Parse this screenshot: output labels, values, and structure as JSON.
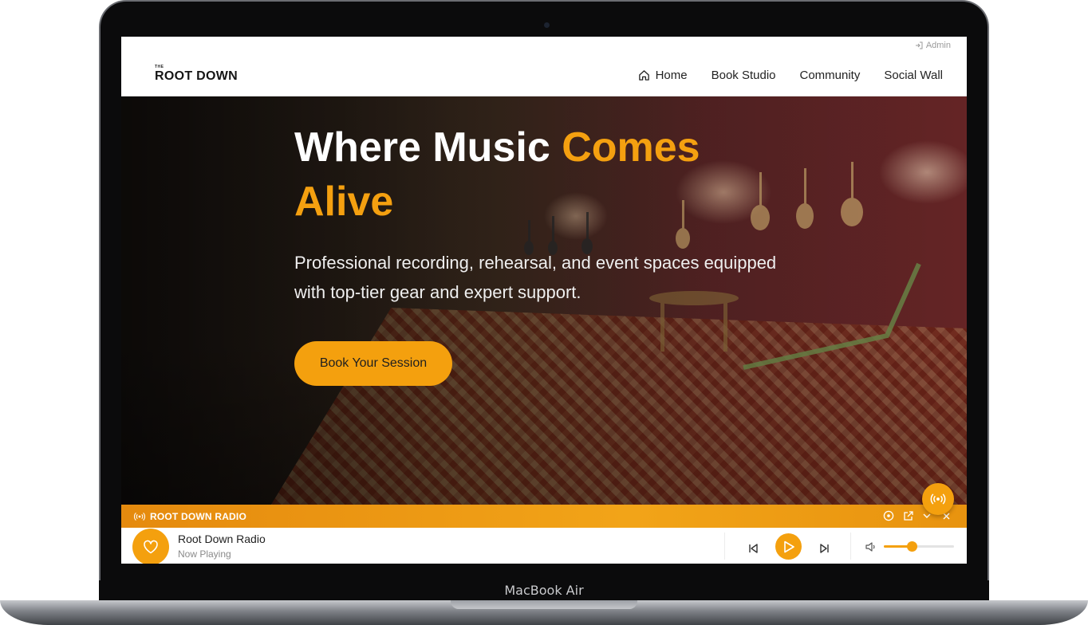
{
  "device": {
    "model_label": "MacBook Air"
  },
  "header": {
    "admin_label": "Admin",
    "logo_small": "THE",
    "logo_big": "ROOT DOWN",
    "nav": [
      {
        "label": "Home",
        "icon": "home-icon"
      },
      {
        "label": "Book Studio"
      },
      {
        "label": "Community"
      },
      {
        "label": "Social Wall"
      }
    ]
  },
  "hero": {
    "title_plain": "Where Music ",
    "title_accent_1": "Comes",
    "title_accent_2": "Alive",
    "subtitle": "Professional recording, rehearsal, and event spaces equipped with top-tier gear and expert support.",
    "cta_label": "Book Your Session"
  },
  "radio": {
    "bar_title": "ROOT DOWN RADIO",
    "track_name": "Root Down Radio",
    "status": "Now Playing",
    "volume": 0.4
  },
  "colors": {
    "accent": "#f4a00e",
    "accent_dark": "#e58a0e",
    "text": "#222222"
  }
}
